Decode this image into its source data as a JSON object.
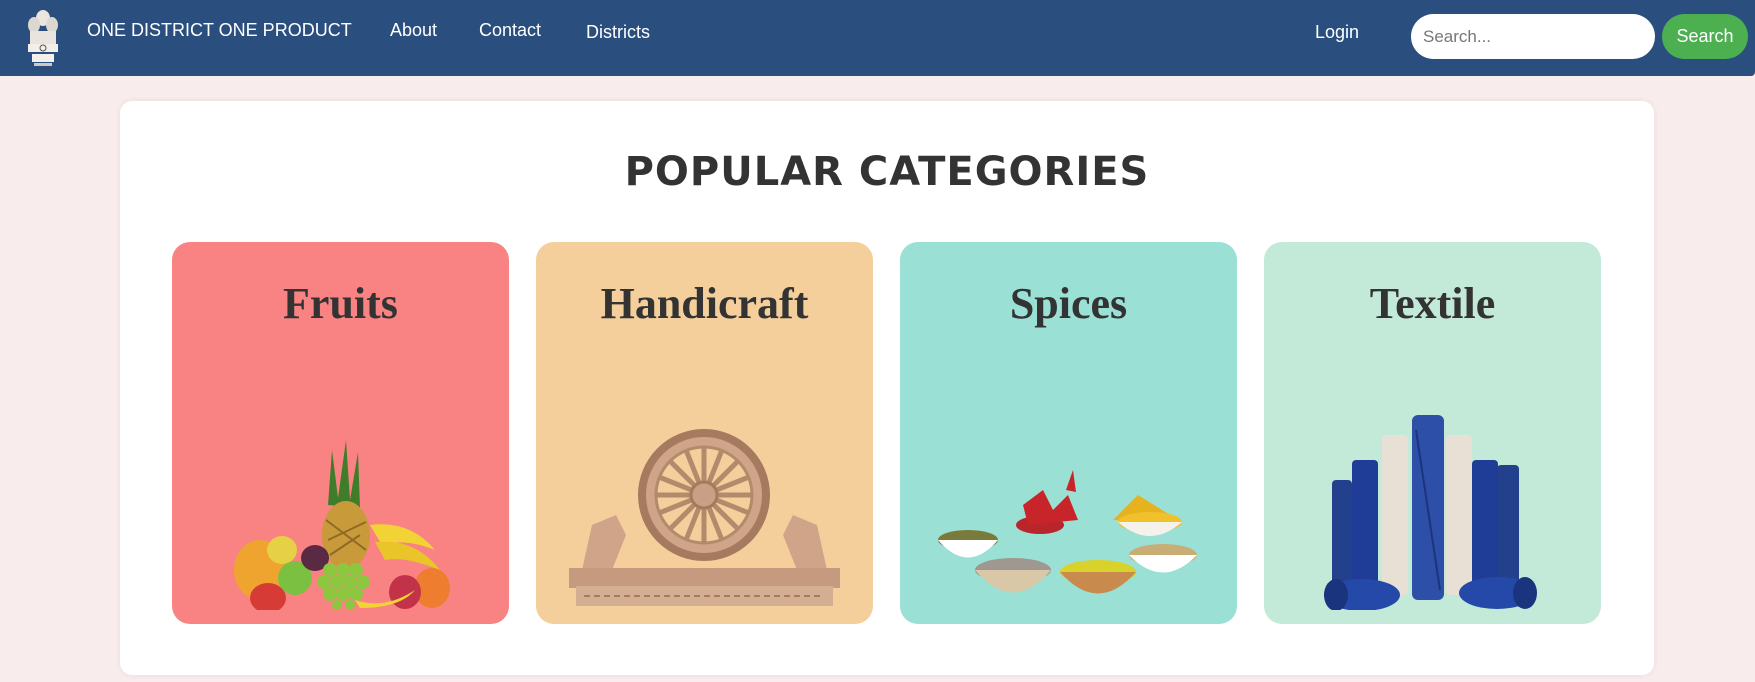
{
  "header": {
    "brand": "ONE DISTRICT ONE PRODUCT",
    "logo_icon": "national-emblem-icon",
    "nav": {
      "about": "About",
      "contact": "Contact",
      "districts": "Districts",
      "login": "Login"
    },
    "search": {
      "placeholder": "Search...",
      "value": "",
      "button_label": "Search"
    },
    "colors": {
      "navbar": "#2a4f7e",
      "search_button": "#4caf50"
    }
  },
  "main": {
    "title": "POPULAR CATEGORIES",
    "categories": [
      {
        "label": "Fruits",
        "color": "#f98383",
        "image": "fruit-basket-image"
      },
      {
        "label": "Handicraft",
        "color": "#f4cf9c",
        "image": "konark-wheel-craft-image"
      },
      {
        "label": "Spices",
        "color": "#9ae0d5",
        "image": "spice-bowls-image"
      },
      {
        "label": "Textile",
        "color": "#c3ead8",
        "image": "fabric-rolls-image"
      }
    ]
  },
  "colors": {
    "page_background": "#f9eced"
  }
}
